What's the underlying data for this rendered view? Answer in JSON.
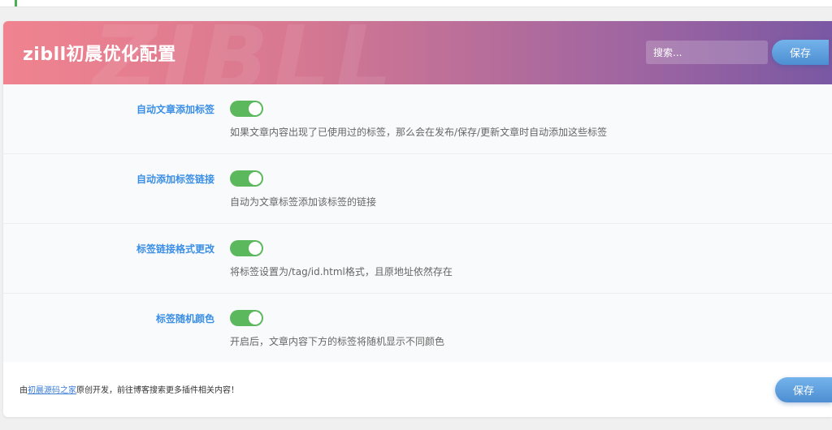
{
  "header": {
    "title": "zibll初晨优化配置",
    "watermark": "ZIBLL",
    "search_placeholder": "搜索...",
    "save_label": "保存"
  },
  "settings": [
    {
      "label": "自动文章添加标签",
      "enabled": true,
      "description": "如果文章内容出现了已使用过的标签，那么会在发布/保存/更新文章时自动添加这些标签"
    },
    {
      "label": "自动添加标签链接",
      "enabled": true,
      "description": "自动为文章标签添加该标签的链接"
    },
    {
      "label": "标签链接格式更改",
      "enabled": true,
      "description": "将标签设置为/tag/id.html格式，且原地址依然存在"
    },
    {
      "label": "标签随机颜色",
      "enabled": true,
      "description": "开启后，文章内容下方的标签将随机显示不同颜色"
    }
  ],
  "footer": {
    "prefix": "由",
    "link_text": "初晨源码之家",
    "suffix": "原创开发，前往博客搜索更多插件相关内容！",
    "save_label": "保存"
  },
  "colors": {
    "toggle_on": "#5cb85c",
    "label": "#3a8ee6",
    "accent_top": "#4caf50"
  }
}
